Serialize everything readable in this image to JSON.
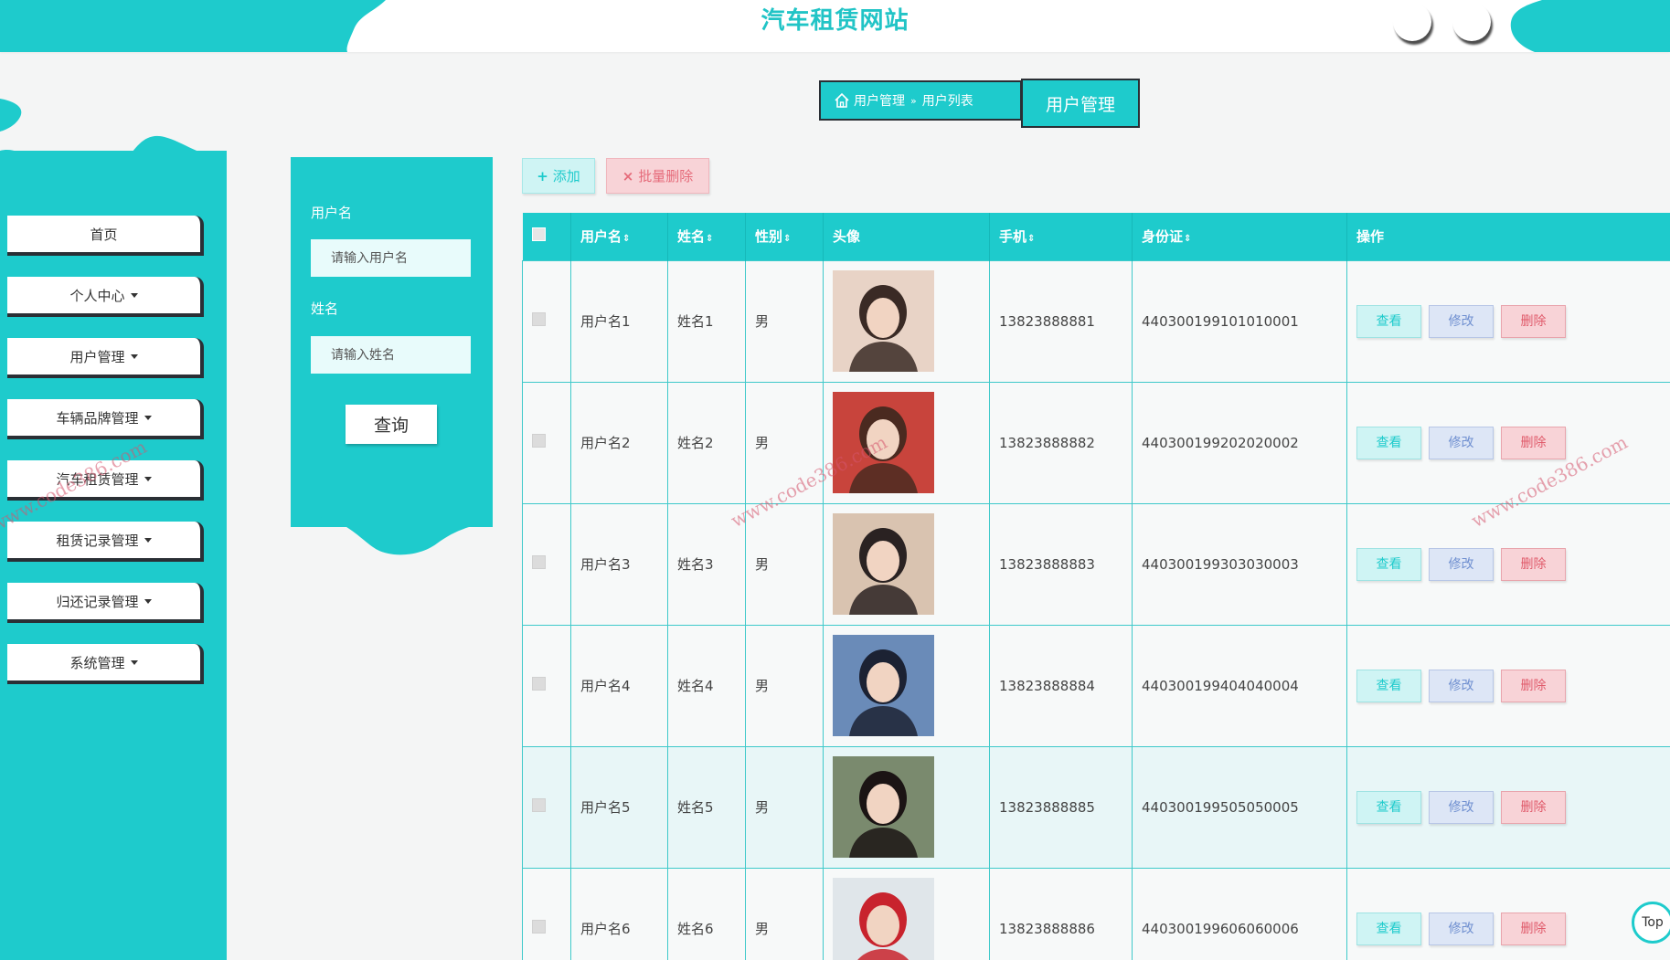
{
  "header": {
    "title": "汽车租赁网站"
  },
  "sidebar": {
    "items": [
      {
        "label": "首页",
        "caret": false
      },
      {
        "label": "个人中心",
        "caret": true
      },
      {
        "label": "用户管理",
        "caret": true
      },
      {
        "label": "车辆品牌管理",
        "caret": true
      },
      {
        "label": "汽车租赁管理",
        "caret": true
      },
      {
        "label": "租赁记录管理",
        "caret": true
      },
      {
        "label": "归还记录管理",
        "caret": true
      },
      {
        "label": "系统管理",
        "caret": true
      }
    ]
  },
  "search": {
    "username_label": "用户名",
    "username_placeholder": "请输入用户名",
    "name_label": "姓名",
    "name_placeholder": "请输入姓名",
    "query_label": "查询"
  },
  "breadcrumb": {
    "home": "用户管理",
    "separator": "»",
    "current": "用户列表",
    "page_title": "用户管理"
  },
  "actions": {
    "add_label": "添加",
    "batch_delete_label": "批量删除"
  },
  "table": {
    "headers": [
      "用户名",
      "姓名",
      "性别",
      "头像",
      "手机",
      "身份证",
      "操作"
    ],
    "view_label": "查看",
    "edit_label": "修改",
    "delete_label": "删除",
    "rows": [
      {
        "username": "用户名1",
        "name": "姓名1",
        "gender": "男",
        "phone": "13823888881",
        "id_card": "440300199101010001"
      },
      {
        "username": "用户名2",
        "name": "姓名2",
        "gender": "男",
        "phone": "13823888882",
        "id_card": "440300199202020002"
      },
      {
        "username": "用户名3",
        "name": "姓名3",
        "gender": "男",
        "phone": "13823888883",
        "id_card": "440300199303030003"
      },
      {
        "username": "用户名4",
        "name": "姓名4",
        "gender": "男",
        "phone": "13823888884",
        "id_card": "440300199404040004"
      },
      {
        "username": "用户名5",
        "name": "姓名5",
        "gender": "男",
        "phone": "13823888885",
        "id_card": "440300199505050005"
      },
      {
        "username": "用户名6",
        "name": "姓名6",
        "gender": "男",
        "phone": "13823888886",
        "id_card": "440300199606060006"
      }
    ]
  },
  "back_to_top": "Top",
  "watermark": "www.code386.com",
  "colors": {
    "accent": "#1ecbcc",
    "dark_border": "#2a2f35",
    "danger": "#e05b6b"
  }
}
